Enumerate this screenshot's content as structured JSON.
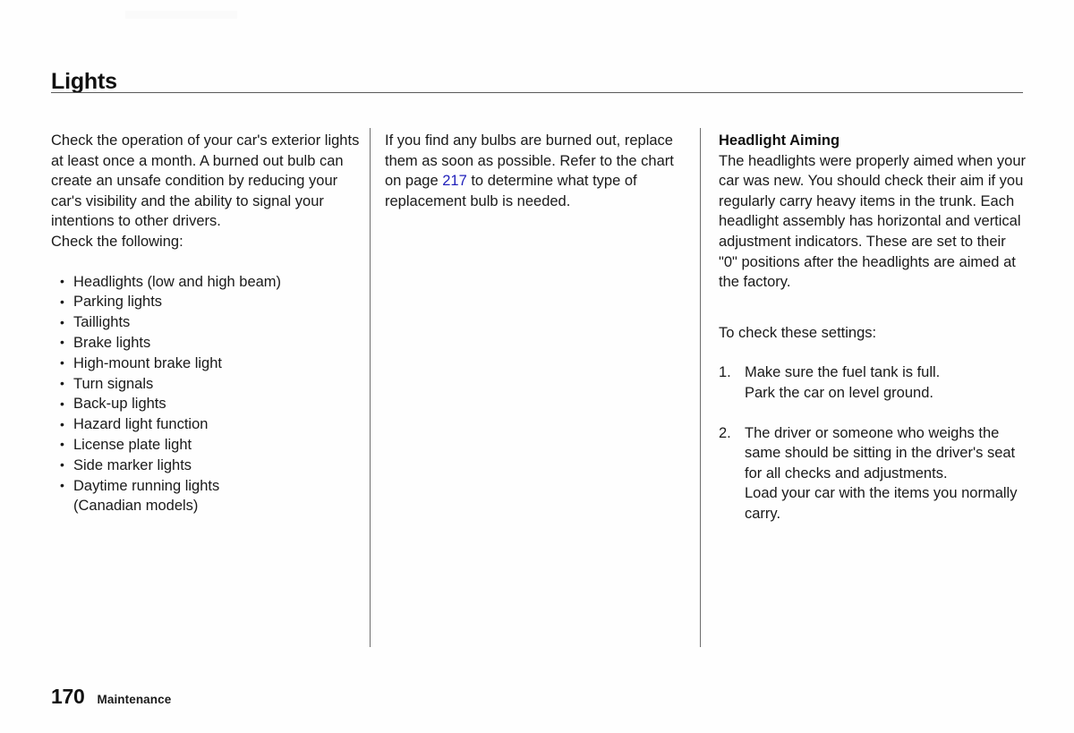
{
  "header": {
    "title": "Lights"
  },
  "columns": {
    "col1": {
      "intro_paragraph": "Check the operation of your car's exterior lights at least once a month. A burned out bulb can create an unsafe condition by reducing your car's visibility and the ability to signal your intentions to other drivers.",
      "check_following_label": "Check the following:",
      "bullets": [
        {
          "text": "Headlights (low and high beam)"
        },
        {
          "text": "Parking lights"
        },
        {
          "text": "Taillights"
        },
        {
          "text": "Brake lights"
        },
        {
          "text": "High-mount brake light"
        },
        {
          "text": "Turn signals"
        },
        {
          "text": "Back-up lights"
        },
        {
          "text": "Hazard light function"
        },
        {
          "text": "License plate light"
        },
        {
          "text": "Side marker lights"
        },
        {
          "text": "Daytime running lights",
          "continuation": "(Canadian models)"
        }
      ]
    },
    "col2": {
      "paragraph_part1": "If you find any bulbs are burned out, replace them as soon as possible. Refer to the chart on page ",
      "page_reference": "217",
      "paragraph_part2": " to determine what type of replacement bulb is needed."
    },
    "col3": {
      "subheading": "Headlight Aiming",
      "paragraph": "The headlights were properly aimed when your car was new. You should check their aim if you regularly carry heavy items in the trunk. Each headlight assembly has horizontal and vertical adjustment indicators. These are set to their \"0\" positions after the headlights are aimed at the factory.",
      "to_check_label": "To check these settings:",
      "steps": [
        {
          "number": "1.",
          "lines": [
            "Make sure the fuel tank is full.",
            "Park the car on level ground."
          ]
        },
        {
          "number": "2.",
          "lines": [
            "The driver or someone who weighs the same should be sitting in the driver's seat for all checks and adjustments.",
            "Load your car with the items you normally carry."
          ]
        }
      ]
    }
  },
  "footer": {
    "page_number": "170",
    "section_name": "Maintenance"
  },
  "colors": {
    "text": "#1a1a1a",
    "cross_reference": "#2222bb",
    "rule": "#5a5a5a"
  }
}
